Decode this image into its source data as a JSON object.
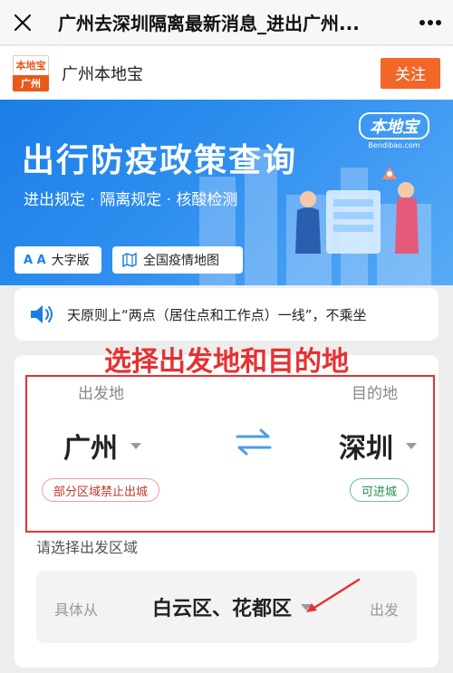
{
  "navbar": {
    "title": "广州去深圳隔离最新消息_进出广州..."
  },
  "account": {
    "logo_top": "本地宝",
    "logo_bottom": "广州",
    "name": "广州本地宝",
    "follow_label": "关注"
  },
  "banner": {
    "brand_cn": "本地宝",
    "brand_en": "Bendibao.com",
    "title": "出行防疫政策查询",
    "subtitle": "进出规定 · 隔离规定 · 核酸检测",
    "large_font_label": "大字版",
    "large_font_glyph": "A A",
    "map_label": "全国疫情地图"
  },
  "notice": {
    "text": "天原则上“两点（居住点和工作点）一线”，不乘坐"
  },
  "headline": "选择出发地和目的地",
  "selector": {
    "from_label": "出发地",
    "to_label": "目的地",
    "from_city": "广州",
    "to_city": "深圳",
    "from_status": "部分区域禁止出城",
    "to_status": "可进城",
    "region_label": "请选择出发区域",
    "region_prefix": "具体从",
    "region_value": "白云区、花都区",
    "region_suffix": "出发"
  },
  "colors": {
    "accent_orange": "#f2662a",
    "banner_blue": "#1b7ee6",
    "annotation_red": "#e53232",
    "status_red": "#c0392b",
    "status_green": "#27914f"
  }
}
